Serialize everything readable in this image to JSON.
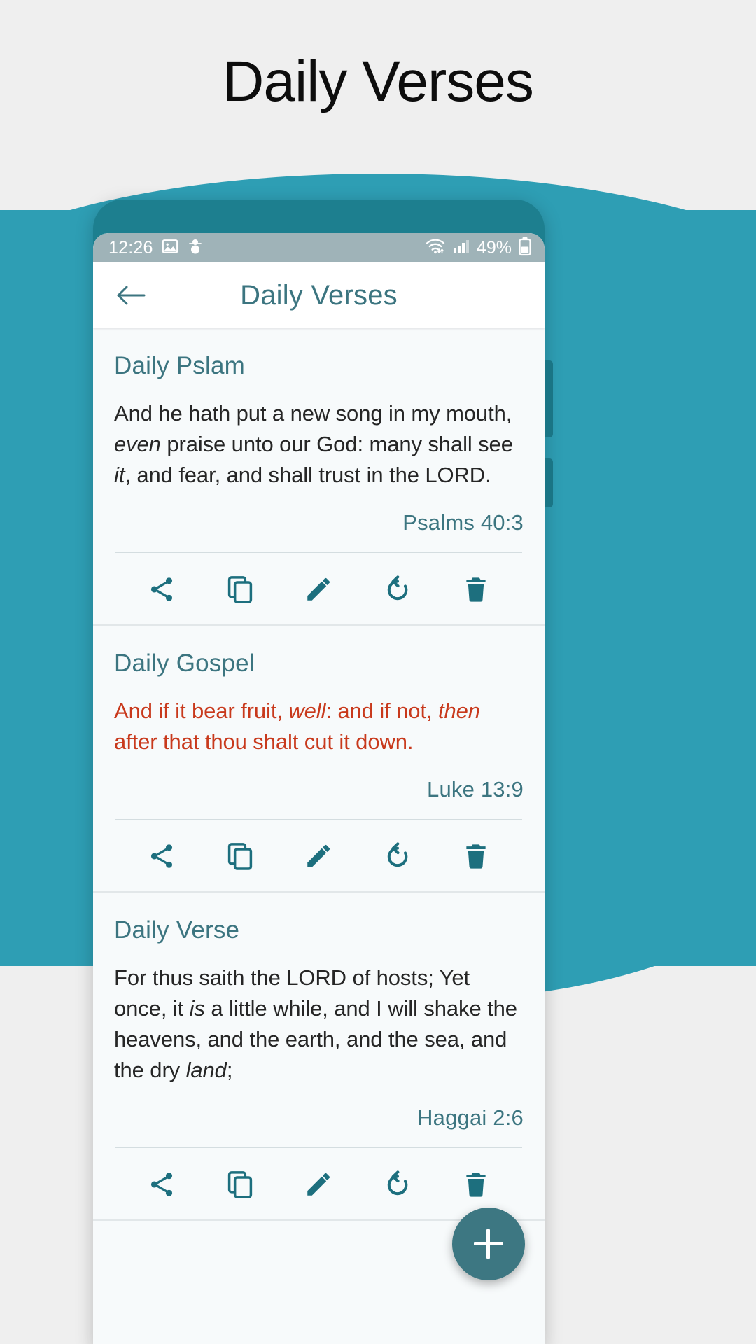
{
  "page": {
    "heading": "Daily Verses",
    "background_color": "#efefef",
    "accent_color": "#2e9eb4"
  },
  "status_bar": {
    "time": "12:26",
    "battery_percent": "49%",
    "icons": [
      "image-icon",
      "snowman-icon",
      "wifi-icon",
      "signal-icon",
      "battery-icon"
    ],
    "background_color": "#9fb3b8"
  },
  "app_bar": {
    "back_label": "back-arrow",
    "title": "Daily Verses",
    "title_color": "#3c7580"
  },
  "actions": {
    "share": "Share",
    "copy": "Copy",
    "edit": "Edit",
    "refresh": "Refresh",
    "delete": "Delete"
  },
  "fab": {
    "label": "+",
    "color": "#3d7782"
  },
  "cards": [
    {
      "title": "Daily Pslam",
      "text_parts": [
        {
          "t": "And he hath put a new song in my mouth, ",
          "i": false
        },
        {
          "t": "even",
          "i": true
        },
        {
          "t": " praise unto our God: many shall see ",
          "i": false
        },
        {
          "t": "it",
          "i": true
        },
        {
          "t": ", and fear, and shall trust in the LORD.",
          "i": false
        }
      ],
      "plain_text": "And he hath put a new song in my mouth, even praise unto our God: many shall see it, and fear, and shall trust in the LORD.",
      "reference": "Psalms 40:3",
      "text_color": "#262626"
    },
    {
      "title": "Daily Gospel",
      "text_parts": [
        {
          "t": "And if it bear fruit, ",
          "i": false
        },
        {
          "t": "well",
          "i": true
        },
        {
          "t": ": and if not, ",
          "i": false
        },
        {
          "t": "then",
          "i": true
        },
        {
          "t": " after that thou shalt cut it down.",
          "i": false
        }
      ],
      "plain_text": "And if it bear fruit, well: and if not, then after that thou shalt cut it down.",
      "reference": "Luke 13:9",
      "text_color": "#c8391c"
    },
    {
      "title": "Daily Verse",
      "text_parts": [
        {
          "t": "For thus saith the LORD of hosts; Yet once, it ",
          "i": false
        },
        {
          "t": "is",
          "i": true
        },
        {
          "t": " a little while, and I will shake the heavens, and the earth, and the sea, and the dry ",
          "i": false
        },
        {
          "t": "land",
          "i": true
        },
        {
          "t": ";",
          "i": false
        }
      ],
      "plain_text": "For thus saith the LORD of hosts; Yet once, it is a little while, and I will shake the heavens, and the earth, and the sea, and the dry land;",
      "reference": "Haggai 2:6",
      "text_color": "#262626"
    }
  ]
}
